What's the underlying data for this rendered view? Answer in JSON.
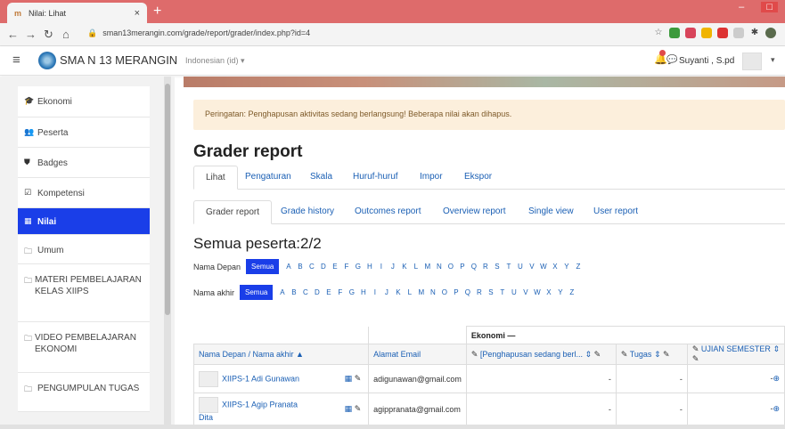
{
  "browser": {
    "tab_title": "Nilai: Lihat",
    "url": "sman13merangin.com/grade/report/grader/index.php?id=4"
  },
  "navbar": {
    "site_name": "SMA N 13 MERANGIN",
    "language": "Indonesian (id) ▾",
    "user_name": "Suyanti , S.pd"
  },
  "drawer": {
    "items": [
      {
        "icon": "graduation-cap-icon",
        "label": "Ekonomi"
      },
      {
        "icon": "users-icon",
        "label": "Peserta"
      },
      {
        "icon": "shield-icon",
        "label": "Badges"
      },
      {
        "icon": "check-square-icon",
        "label": "Kompetensi"
      },
      {
        "icon": "table-icon",
        "label": "Nilai",
        "active": true
      },
      {
        "icon": "folder-icon",
        "label": "Umum"
      },
      {
        "icon": "folder-icon",
        "label": "MATERI PEMBELAJARAN KELAS XIIPS"
      },
      {
        "icon": "folder-icon",
        "label": "VIDEO PEMBELAJARAN EKONOMI"
      },
      {
        "icon": "folder-icon",
        "label": "PENGUMPULAN TUGAS"
      }
    ]
  },
  "alert": "Peringatan: Penghapusan aktivitas sedang berlangsung! Beberapa nilai akan dihapus.",
  "page_title": "Grader report",
  "tabs_primary": [
    "Lihat",
    "Pengaturan",
    "Skala",
    "Huruf-huruf",
    "Impor",
    "Ekspor"
  ],
  "tabs_secondary": [
    "Grader report",
    "Grade history",
    "Outcomes report",
    "Overview report",
    "Single view",
    "User report"
  ],
  "subtitle": "Semua peserta:2/2",
  "filter": {
    "first_name_label": "Nama Depan",
    "last_name_label": "Nama akhir",
    "all_label": "Semua",
    "letters": [
      "A",
      "B",
      "C",
      "D",
      "E",
      "F",
      "G",
      "H",
      "I",
      "J",
      "K",
      "L",
      "M",
      "N",
      "O",
      "P",
      "Q",
      "R",
      "S",
      "T",
      "U",
      "V",
      "W",
      "X",
      "Y",
      "Z"
    ]
  },
  "table": {
    "category": "Ekonomi —",
    "col_name": "Nama Depan / Nama akhir ▲",
    "col_email": "Alamat Email",
    "col_item1": "[Penghapusan sedang berl...",
    "col_item2": "Tugas",
    "col_item3": "UJIAN SEMESTER",
    "rows": [
      {
        "name": "XIIPS-1 Adi Gunawan",
        "email": "adigunawan@gmail.com",
        "g1": "-",
        "g2": "-",
        "g3": "-"
      },
      {
        "name": "XIIPS-1 Agip Pranata",
        "name2": "Dita",
        "email": "agippranata@gmail.com",
        "g1": "-",
        "g2": "-",
        "g3": "-"
      }
    ]
  }
}
